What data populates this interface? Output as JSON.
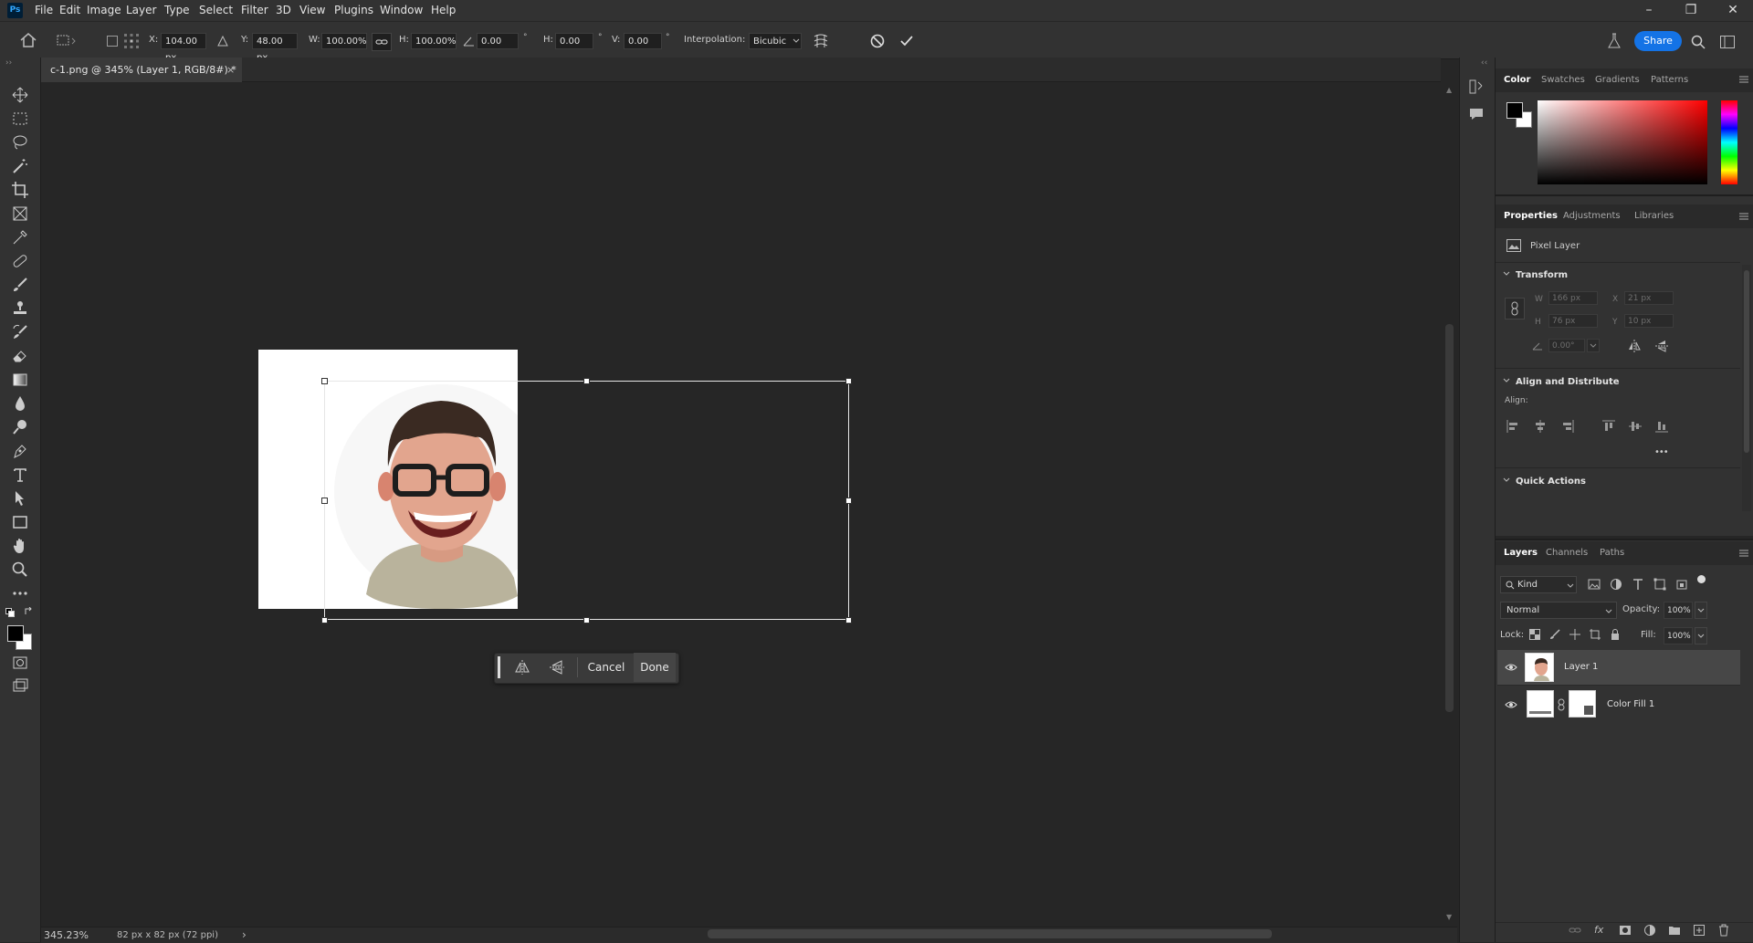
{
  "app": {
    "logo": "Ps"
  },
  "menu": [
    "File",
    "Edit",
    "Image",
    "Layer",
    "Type",
    "Select",
    "Filter",
    "3D",
    "View",
    "Plugins",
    "Window",
    "Help"
  ],
  "window_controls": {
    "minimize": "–",
    "restore": "❐",
    "close": "✕"
  },
  "options": {
    "x_label": "X:",
    "x_value": "104.00 px",
    "y_label": "Y:",
    "y_value": "48.00 px",
    "w_label": "W:",
    "w_value": "100.00%",
    "h_label": "H:",
    "h_value": "100.00%",
    "angle_value": "0.00",
    "hskew_label": "H:",
    "hskew_value": "0.00",
    "vskew_label": "V:",
    "vskew_value": "0.00",
    "degree": "°",
    "interp_label": "Interpolation:",
    "interp_value": "Bicubic",
    "share_label": "Share"
  },
  "document": {
    "tab_title": "c-1.png @ 345% (Layer 1, RGB/8#) *",
    "close": "×"
  },
  "status": {
    "zoom": "345.23%",
    "doc_info": "82 px x 82 px (72 ppi)",
    "arrow": "›"
  },
  "floating_bar": {
    "cancel": "Cancel",
    "done": "Done"
  },
  "color_panel": {
    "tabs": [
      "Color",
      "Swatches",
      "Gradients",
      "Patterns"
    ]
  },
  "properties_panel": {
    "tabs": [
      "Properties",
      "Adjustments",
      "Libraries"
    ],
    "layer_type": "Pixel Layer",
    "transform_title": "Transform",
    "w_label": "W",
    "w_value": "166 px",
    "h_label": "H",
    "h_value": "76 px",
    "x_label": "X",
    "x_value": "21 px",
    "y_label": "Y",
    "y_value": "10 px",
    "angle_value": "0.00°",
    "align_title": "Align and Distribute",
    "align_label": "Align:",
    "more": "•••",
    "quick_title": "Quick Actions"
  },
  "layers_panel": {
    "tabs": [
      "Layers",
      "Channels",
      "Paths"
    ],
    "kind_label": "Kind",
    "blend_mode": "Normal",
    "opacity_label": "Opacity:",
    "opacity_value": "100%",
    "lock_label": "Lock:",
    "fill_label": "Fill:",
    "fill_value": "100%",
    "layers": [
      {
        "name": "Layer 1"
      },
      {
        "name": "Color Fill 1"
      }
    ]
  },
  "colors": {
    "accent": "#1473e6",
    "bg": "#262626",
    "panel": "#323232"
  }
}
